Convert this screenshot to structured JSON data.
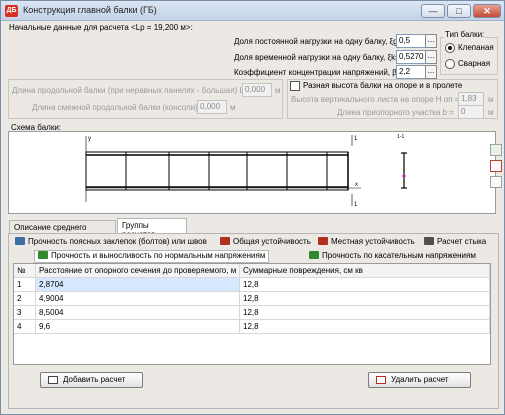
{
  "window": {
    "title": "Конструкция главной балки (ГБ)",
    "app_icon": "ДБ",
    "minimize_icon": "—",
    "maximize_icon": "□",
    "close_icon": "✕"
  },
  "initial_data": {
    "label": "Начальные данные для расчета <Lp = 19,200 м>:",
    "permanent_load_label": "Доля постоянной нагрузки на одну балку, ξg=",
    "permanent_load_value": "0,5",
    "temporary_load_label": "Доля временной нагрузки на одну балку, ξk=",
    "temporary_load_value": "0,5270",
    "stress_coef_label": "Коэффициент концентрации напряжений, β =",
    "stress_coef_value": "2,2",
    "dots": "..."
  },
  "beam_type": {
    "label": "Тип балки:",
    "options": [
      "Клепаная",
      "Сварная"
    ],
    "selected": "Клепаная"
  },
  "lengths": {
    "longitudinal_label": "Длина продольной балки (при неравных панелях - большая) Lб =",
    "longitudinal_value": "0,000",
    "longitudinal_unit": "м",
    "adjacent_label": "Длина смежной продольной балки (консоли) =",
    "adjacent_value": "0,000",
    "adjacent_unit": "м"
  },
  "height_diff": {
    "checkbox_label": "Разная высота балки на опоре и в пролете",
    "vertical_height_label": "Высота вертикального листа на опоре H оп =",
    "vertical_height_value": "1,83",
    "vertical_height_unit": "м",
    "support_length_label": "Длина приопорного участка b =",
    "support_length_value": "0",
    "support_length_unit": "м"
  },
  "schema": {
    "label": "Схема балки:",
    "axis_y": "y",
    "axis_x": "x",
    "section_label": "1-1",
    "marker": "1"
  },
  "tabs": [
    {
      "label": "Описание среднего сечения",
      "active": false
    },
    {
      "label": "Группы расчетов",
      "active": true
    }
  ],
  "subtabs_row1": [
    {
      "label": "Прочность поясных заклепок (болтов) или швов",
      "color": "#3a6ea5"
    },
    {
      "label": "Общая устойчивость",
      "color": "#b03020"
    },
    {
      "label": "Местная устойчивость",
      "color": "#b03020"
    },
    {
      "label": "Расчет стыка",
      "color": "#505050"
    }
  ],
  "subtabs_row2": [
    {
      "label": "Прочность и выносливость по нормальным напряжениям",
      "color": "#2f8a2f",
      "active": true
    },
    {
      "label": "Прочность по касательным напряжениям",
      "color": "#2f8a2f",
      "active": false
    }
  ],
  "table": {
    "headers": [
      "№",
      "Расстояние от опорного сечения до проверяемого, м",
      "Суммарные повреждения, см кв"
    ],
    "rows": [
      {
        "n": "1",
        "distance": "2,8704",
        "damage": "12,8"
      },
      {
        "n": "2",
        "distance": "4,9004",
        "damage": "12,8"
      },
      {
        "n": "3",
        "distance": "8,5004",
        "damage": "12,8"
      },
      {
        "n": "4",
        "distance": "9,6",
        "damage": "12,8"
      }
    ]
  },
  "buttons": {
    "add": "Добавить расчет",
    "delete": "Удалить расчет"
  },
  "colors": {
    "selected_row": "#d6e8ff",
    "window_bg": "#ece9e4"
  }
}
